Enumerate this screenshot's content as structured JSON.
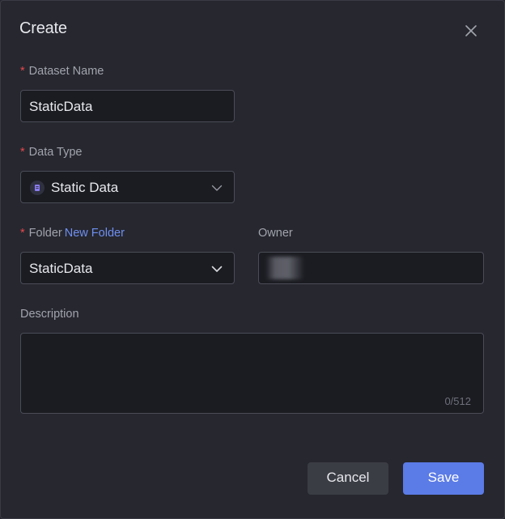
{
  "dialog": {
    "title": "Create",
    "close_icon": "close-icon"
  },
  "dataset_name": {
    "required_mark": "*",
    "label": "Dataset Name",
    "value": "StaticData"
  },
  "data_type": {
    "required_mark": "*",
    "label": "Data Type",
    "value": "Static Data",
    "icon": "static-data-icon"
  },
  "folder": {
    "required_mark": "*",
    "label": "Folder",
    "new_folder_link": "New Folder",
    "value": "StaticData"
  },
  "owner": {
    "label": "Owner"
  },
  "description": {
    "label": "Description",
    "value": "",
    "counter": "0/512"
  },
  "footer": {
    "cancel_label": "Cancel",
    "save_label": "Save"
  },
  "colors": {
    "background": "#26272f",
    "field_background": "#1b1c22",
    "accent": "#5b7be6",
    "link": "#6f8ff0",
    "required": "#e5484d"
  }
}
